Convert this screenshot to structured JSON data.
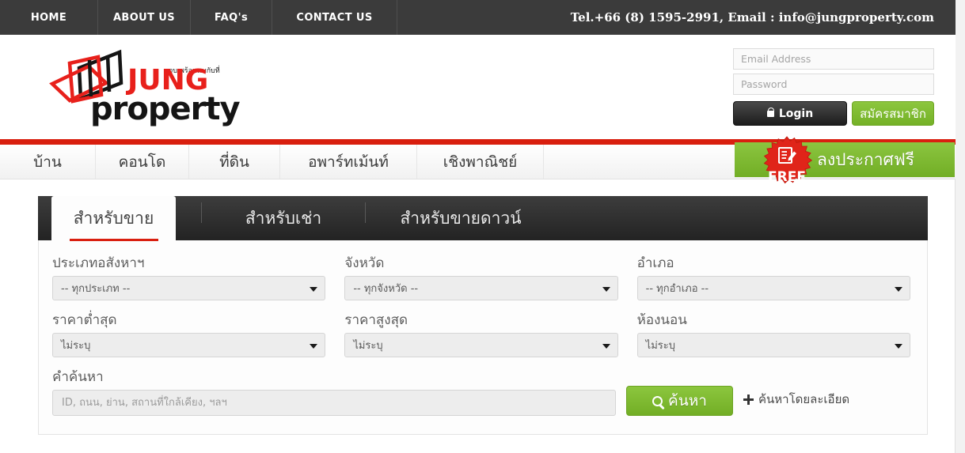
{
  "topbar": {
    "nav": [
      {
        "label": "HOME"
      },
      {
        "label": "ABOUT US"
      },
      {
        "label": "FAQ's"
      },
      {
        "label": "CONTACT US"
      }
    ],
    "contact": "Tel.+66 (8) 1595-2991, Email : info@jungproperty.com"
  },
  "logo": {
    "brand_top": "JUNG",
    "brand_bottom": "property",
    "tagline_thai": "จบ พร้อมพบกับที่",
    "color_red": "#e8201b",
    "color_black": "#151515"
  },
  "login": {
    "email_placeholder": "Email Address",
    "email_value": "",
    "password_placeholder": "Password",
    "password_value": "",
    "login_label": "Login",
    "register_label": "สมัครสมาชิก"
  },
  "mainnav": {
    "items": [
      {
        "label": "บ้าน"
      },
      {
        "label": "คอนโด"
      },
      {
        "label": "ที่ดิน"
      },
      {
        "label": "อพาร์ทเม้นท์"
      },
      {
        "label": "เชิงพาณิชย์"
      }
    ],
    "post_free_label": "ลงประกาศฟรี",
    "free_badge": "FREE",
    "accent_red": "#d91f0f",
    "accent_green": "#7fbb33"
  },
  "search": {
    "tabs": [
      {
        "label": "สำหรับขาย",
        "active": true
      },
      {
        "label": "สำหรับเช่า",
        "active": false
      },
      {
        "label": "สำหรับขายดาวน์",
        "active": false
      }
    ],
    "fields": {
      "property_type": {
        "label": "ประเภทอสังหาฯ",
        "value": "-- ทุกประเภท --"
      },
      "province": {
        "label": "จังหวัด",
        "value": "-- ทุกจังหวัด --"
      },
      "district": {
        "label": "อำเภอ",
        "value": "-- ทุกอำเภอ --"
      },
      "price_min": {
        "label": "ราคาต่ำสุด",
        "value": "ไม่ระบุ"
      },
      "price_max": {
        "label": "ราคาสูงสุด",
        "value": "ไม่ระบุ"
      },
      "bedrooms": {
        "label": "ห้องนอน",
        "value": "ไม่ระบุ"
      },
      "keyword": {
        "label": "คำค้นหา",
        "value": "",
        "placeholder": "ID, ถนน, ย่าน, สถานที่ใกล้เคียง, ฯลฯ"
      }
    },
    "search_button": "ค้นหา",
    "advanced_link": "ค้นหาโดยละเอียด"
  }
}
